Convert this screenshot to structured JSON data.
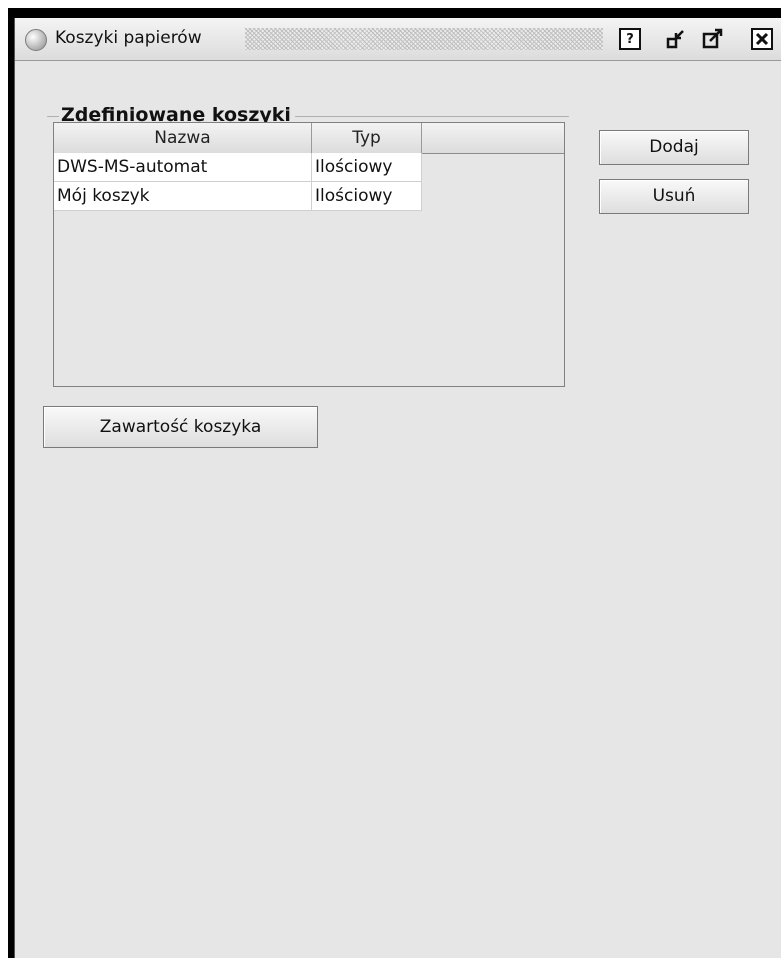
{
  "window": {
    "title": "Koszyki papierów",
    "buttons": {
      "help": "?",
      "minimize": "▫",
      "maximize": "⤢",
      "close": "✕"
    }
  },
  "group": {
    "legend": "Zdefiniowane koszyki"
  },
  "table": {
    "columns": [
      "Nazwa",
      "Typ"
    ],
    "rows": [
      {
        "name": "DWS-MS-automat",
        "type": "Ilościowy"
      },
      {
        "name": "Mój koszyk",
        "type": "Ilościowy"
      }
    ]
  },
  "actions": {
    "add_label": "Dodaj",
    "remove_label": "Usuń",
    "contents_label": "Zawartość koszyka"
  }
}
